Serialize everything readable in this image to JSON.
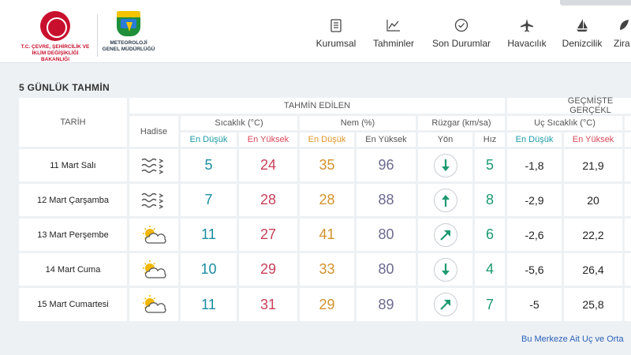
{
  "header": {
    "ministry_logo_text": "T.C. ÇEVRE, ŞEHİRCİLİK VE İKLİM DEĞİŞİKLİĞİ BAKANLIĞI",
    "mgm_logo_text": "METEOROLOJİ GENEL MÜDÜRLÜĞÜ",
    "nav": [
      {
        "label": "Kurumsal",
        "icon": "document-icon"
      },
      {
        "label": "Tahminler",
        "icon": "chart-line-icon"
      },
      {
        "label": "Son Durumlar",
        "icon": "check-circle-icon"
      },
      {
        "label": "Havacılık",
        "icon": "airplane-icon"
      },
      {
        "label": "Denizcilik",
        "icon": "sailboat-icon"
      },
      {
        "label": "Zira",
        "icon": "leaf-icon"
      }
    ]
  },
  "section_title": "5 GÜNLÜK TAHMİN",
  "table": {
    "group_forecast": "TAHMİN EDİLEN",
    "group_past": "GEÇMİŞTE GERÇEKL",
    "col_date": "TARİH",
    "col_event": "Hadise",
    "col_temp": "Sıcaklık (°C)",
    "col_humidity": "Nem (%)",
    "col_wind": "Rüzgar (km/sa)",
    "col_past_temp": "Uç Sıcaklık (°C)",
    "sub_low": "En Düşük",
    "sub_high": "En Yüksek",
    "sub_dir": "Yön",
    "sub_speed": "Hız",
    "rows": [
      {
        "date": "11 Mart Salı",
        "event": "windy-icon",
        "tmin": "5",
        "tmax": "24",
        "hmin": "35",
        "hmax": "96",
        "wind_dir": "down",
        "wind_speed": "5",
        "past_min": "-1,8",
        "past_max": "21,9"
      },
      {
        "date": "12 Mart Çarşamba",
        "event": "windy-icon",
        "tmin": "7",
        "tmax": "28",
        "hmin": "28",
        "hmax": "88",
        "wind_dir": "up",
        "wind_speed": "8",
        "past_min": "-2,9",
        "past_max": "20"
      },
      {
        "date": "13 Mart Perşembe",
        "event": "partly-cloudy-icon",
        "tmin": "11",
        "tmax": "27",
        "hmin": "41",
        "hmax": "80",
        "wind_dir": "up-right",
        "wind_speed": "6",
        "past_min": "-2,6",
        "past_max": "22,2"
      },
      {
        "date": "14 Mart Cuma",
        "event": "partly-cloudy-icon",
        "tmin": "10",
        "tmax": "29",
        "hmin": "33",
        "hmax": "80",
        "wind_dir": "down",
        "wind_speed": "4",
        "past_min": "-5,6",
        "past_max": "26,4"
      },
      {
        "date": "15 Mart Cumartesi",
        "event": "partly-cloudy-icon",
        "tmin": "11",
        "tmax": "31",
        "hmin": "29",
        "hmax": "89",
        "wind_dir": "up-right",
        "wind_speed": "7",
        "past_min": "-5",
        "past_max": "25,8"
      }
    ]
  },
  "footer_link": "Bu Merkeze Ait Uç ve Orta",
  "colors": {
    "low": "#1b8da0",
    "high": "#c9405a",
    "humidity_low": "#d2922b",
    "humidity_high": "#6d6a8f",
    "speed": "#1b9a6e",
    "arrow": "#1b9a6e"
  }
}
